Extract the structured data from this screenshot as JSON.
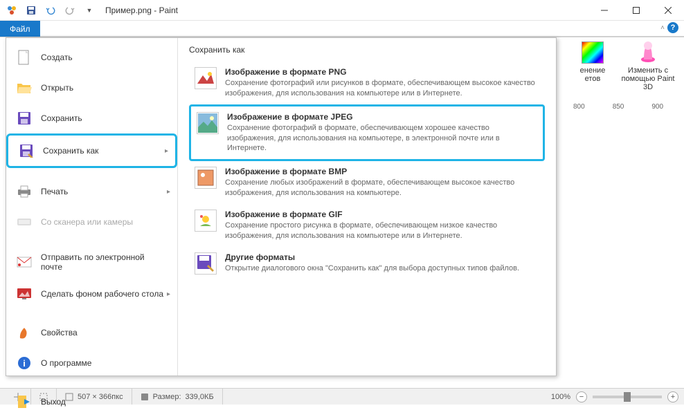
{
  "window": {
    "title": "Пример.png - Paint"
  },
  "tabs": {
    "file": "Файл"
  },
  "ribbon": {
    "item1_line1": "енение",
    "item1_line2": "етов",
    "item2_line1": "Изменить с",
    "item2_line2": "помощью Paint 3D"
  },
  "ruler": {
    "t1": "800",
    "t2": "850",
    "t3": "900"
  },
  "menu": {
    "items": [
      {
        "label": "Создать",
        "arrow": false
      },
      {
        "label": "Открыть",
        "arrow": false
      },
      {
        "label": "Сохранить",
        "arrow": false
      },
      {
        "label": "Сохранить как",
        "arrow": true,
        "selected": true
      },
      {
        "label": "Печать",
        "arrow": true
      },
      {
        "label": "Со сканера или камеры",
        "arrow": false,
        "disabled": true
      },
      {
        "label": "Отправить по электронной почте",
        "arrow": false
      },
      {
        "label": "Сделать фоном рабочего стола",
        "arrow": true
      },
      {
        "label": "Свойства",
        "arrow": false
      },
      {
        "label": "О программе",
        "arrow": false
      },
      {
        "label": "Выход",
        "arrow": false
      }
    ]
  },
  "submenu": {
    "title": "Сохранить как",
    "items": [
      {
        "title": "Изображение в формате PNG",
        "desc": "Сохранение фотографий или рисунков в формате, обеспечивающем высокое качество изображения, для использования на компьютере или в Интернете."
      },
      {
        "title": "Изображение в формате JPEG",
        "desc": "Сохранение фотографий в формате, обеспечивающем хорошее качество изображения, для использования на компьютере, в электронной почте или в Интернете.",
        "highlighted": true
      },
      {
        "title": "Изображение в формате BMP",
        "desc": "Сохранение любых изображений в формате, обеспечивающем высокое качество изображения, для использования на компьютере."
      },
      {
        "title": "Изображение в формате GIF",
        "desc": "Сохранение простого рисунка в формате, обеспечивающем низкое качество изображения, для использования на компьютере или в Интернете."
      },
      {
        "title": "Другие форматы",
        "desc": "Открытие диалогового окна \"Сохранить как\" для выбора доступных типов файлов."
      }
    ]
  },
  "status": {
    "dims": "507 × 366пкс",
    "size_label": "Размер:",
    "size_val": "339,0КБ",
    "zoom": "100%"
  }
}
